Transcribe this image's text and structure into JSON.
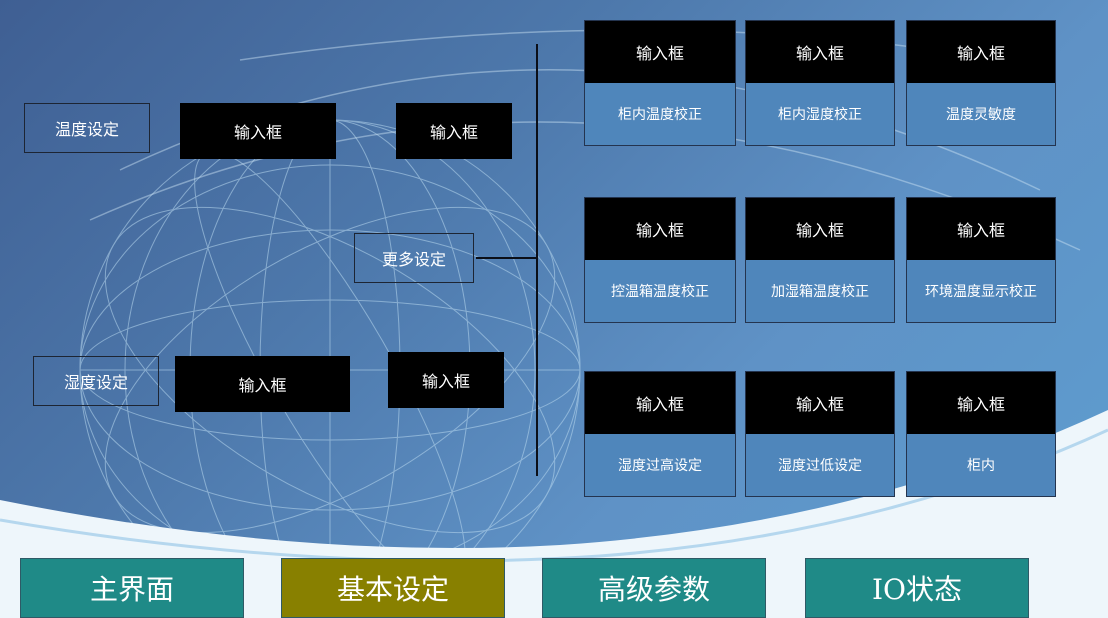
{
  "settings": {
    "temp_label": "温度设定",
    "humid_label": "湿度设定",
    "more_label": "更多设定",
    "input_placeholder": "输入框"
  },
  "calibration": [
    {
      "label": "柜内温度校正",
      "input": "输入框"
    },
    {
      "label": "柜内湿度校正",
      "input": "输入框"
    },
    {
      "label": "温度灵敏度",
      "input": "输入框"
    },
    {
      "label": "控温箱温度校正",
      "input": "输入框"
    },
    {
      "label": "加湿箱温度校正",
      "input": "输入框"
    },
    {
      "label": "环境温度显示校正",
      "input": "输入框"
    },
    {
      "label": "湿度过高设定",
      "input": "输入框"
    },
    {
      "label": "湿度过低设定",
      "input": "输入框"
    },
    {
      "label": "柜内",
      "input": "输入框"
    }
  ],
  "nav": [
    {
      "label": "主界面",
      "active": false
    },
    {
      "label": "基本设定",
      "active": true
    },
    {
      "label": "高级参数",
      "active": false
    },
    {
      "label": "IO状态",
      "active": false
    }
  ],
  "colors": {
    "nav_inactive": "#1f8a87",
    "nav_active": "#888000",
    "input_bg": "#000000",
    "card_label_bg": "#4f86bb"
  }
}
